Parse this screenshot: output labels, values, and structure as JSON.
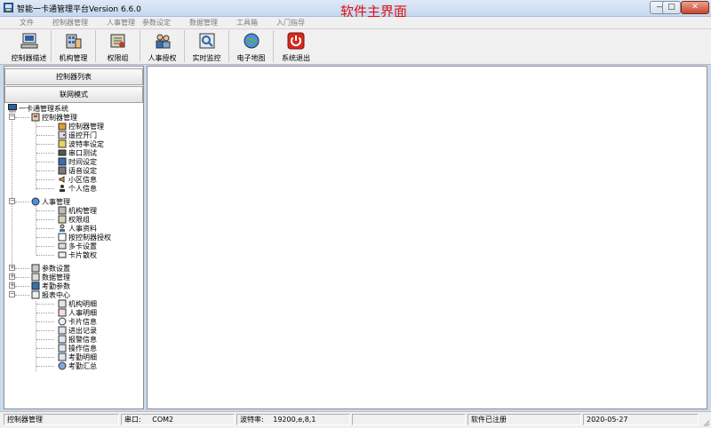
{
  "window": {
    "title": "智能一卡通管理平台Version 6.6.0",
    "overlay_caption": "软件主界面",
    "caption_color": "#e01010",
    "minimize_glyph": "—",
    "maximize_glyph": "□",
    "close_glyph": "✕"
  },
  "menu": [
    {
      "label": "文件"
    },
    {
      "label": "控制器管理"
    },
    {
      "label": "人事管理"
    },
    {
      "label": "参数设定"
    },
    {
      "label": "数据管理"
    },
    {
      "label": "工具箱"
    },
    {
      "label": "入门指导"
    }
  ],
  "toolbar": [
    {
      "label": "控制器描述",
      "icon": "computer-icon"
    },
    {
      "label": "机构管理",
      "icon": "building-icon"
    },
    {
      "label": "权限组",
      "icon": "permission-icon"
    },
    {
      "label": "人事授权",
      "icon": "people-icon"
    },
    {
      "label": "实时监控",
      "icon": "monitor-icon"
    },
    {
      "label": "电子地图",
      "icon": "map-icon"
    },
    {
      "label": "系统退出",
      "icon": "power-icon"
    }
  ],
  "leftpane": {
    "controller_list_button": "控制器列表",
    "online_mode_button": "联网模式"
  },
  "tree": {
    "root": "一卡通管理系统",
    "groups": [
      {
        "label": "控制器管理",
        "expanded": true,
        "children": [
          "控制器管理",
          "遥控开门",
          "波特率设定",
          "串口测试",
          "时间设定",
          "语音设定",
          "小区信息",
          "个人信息"
        ]
      },
      {
        "label": "人事管理",
        "expanded": true,
        "children": [
          "机构管理",
          "权限组",
          "人事资料",
          "按控制器授权",
          "多卡设置",
          "卡片散权"
        ]
      },
      {
        "label": "参数设置",
        "expanded": false,
        "children": []
      },
      {
        "label": "数据管理",
        "expanded": false,
        "children": []
      },
      {
        "label": "考勤参数",
        "expanded": false,
        "children": []
      },
      {
        "label": "报表中心",
        "expanded": true,
        "children": [
          "机构明细",
          "人事明细",
          "卡片信息",
          "进出记录",
          "报警信息",
          "操作信息",
          "考勤明细",
          "考勤汇总"
        ]
      }
    ]
  },
  "statusbar": {
    "mode": "控制器管理",
    "serial_label": "串口:",
    "serial_value": "COM2",
    "baud_label": "波特率:",
    "baud_value": "19200,e,8,1",
    "register": "软件已注册",
    "date": "2020-05-27"
  }
}
